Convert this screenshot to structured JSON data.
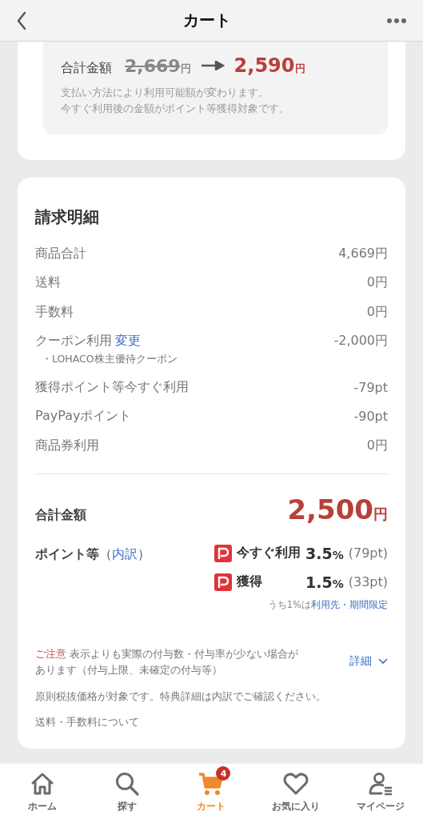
{
  "header": {
    "title": "カート"
  },
  "summary_box": {
    "label": "合計金額",
    "old_amount": "2,669",
    "old_unit": "円",
    "new_amount": "2,590",
    "new_unit": "円",
    "notes": [
      "支払い方法により利用可能額が変わります。",
      "今すぐ利用後の金額がポイント等獲得対象です。"
    ]
  },
  "billing": {
    "title": "請求明細",
    "rows": [
      {
        "label": "商品合計",
        "value": "4,669円"
      },
      {
        "label": "送料",
        "value": "0円"
      },
      {
        "label": "手数料",
        "value": "0円"
      },
      {
        "label": "クーポン利用",
        "link": "変更",
        "value": "-2,000円",
        "sub": "・LOHACO株主優待クーポン"
      },
      {
        "label": "獲得ポイント等今すぐ利用",
        "value": "-79pt"
      },
      {
        "label": "PayPayポイント",
        "value": "-90pt"
      },
      {
        "label": "商品券利用",
        "value": "0円"
      }
    ],
    "total": {
      "label": "合計金額",
      "amount": "2,500",
      "unit": "円"
    },
    "points": {
      "label": "ポイント等",
      "open": "（",
      "link": "内訳",
      "close": "）",
      "rows": [
        {
          "label": "今すぐ利用",
          "rate": "3.5",
          "unit": "%",
          "pts": "(79pt)"
        },
        {
          "label": "獲得",
          "rate": "1.5",
          "unit": "%",
          "pts": "(33pt)"
        }
      ],
      "note": "うち1%は",
      "note_link": "利用先・期間限定"
    },
    "notice": {
      "tag": "ご注意",
      "text": "表示よりも実際の付与数・付与率が少ない場合があります（付与上限、未確定の付与等）",
      "detail": "詳細"
    },
    "lines": [
      "原則税抜価格が対象です。特典詳細は内訳でご確認ください。",
      "送料・手数料について"
    ]
  },
  "tabs": [
    {
      "label": "ホーム",
      "selected": false
    },
    {
      "label": "探す",
      "selected": false
    },
    {
      "label": "カート",
      "selected": true,
      "badge": "4"
    },
    {
      "label": "お気に入り",
      "selected": false
    },
    {
      "label": "マイページ",
      "selected": false
    }
  ]
}
